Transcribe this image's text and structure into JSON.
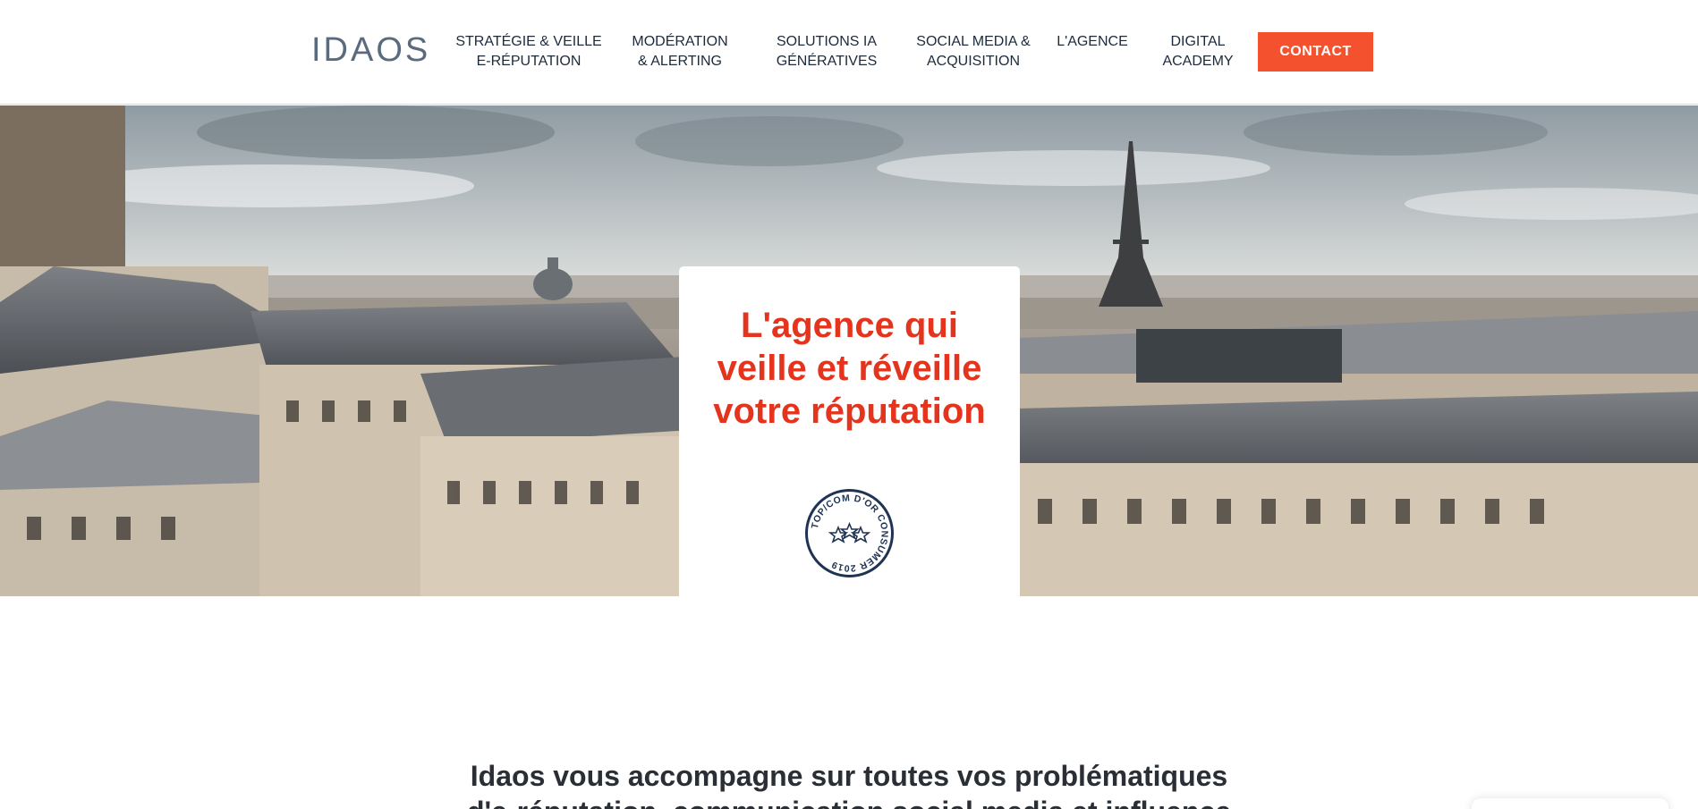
{
  "header": {
    "logo_text": "IDAOS",
    "nav": [
      {
        "label": "STRATÉGIE & VEILLE\nE-RÉPUTATION"
      },
      {
        "label": "MODÉRATION\n& ALERTING"
      },
      {
        "label": "SOLUTIONS IA\nGÉNÉRATIVES"
      },
      {
        "label": "SOCIAL MEDIA &\nACQUISITION"
      },
      {
        "label": "L'AGENCE"
      },
      {
        "label": "DIGITAL\nACADEMY"
      }
    ],
    "contact_label": "CONTACT"
  },
  "hero": {
    "headline": "L'agence qui veille et réveille votre réputation",
    "badge_text": "TOP/COM D'OR CONSUMER 2019"
  },
  "intro": {
    "line1": "Idaos vous accompagne sur toutes vos problématiques",
    "line2": "d'e-réputation, communication social media et influence"
  },
  "colors": {
    "accent": "#f4522e",
    "headline_red": "#e5341d",
    "nav_text": "#1d2a3a",
    "badge_navy": "#1f3352"
  }
}
